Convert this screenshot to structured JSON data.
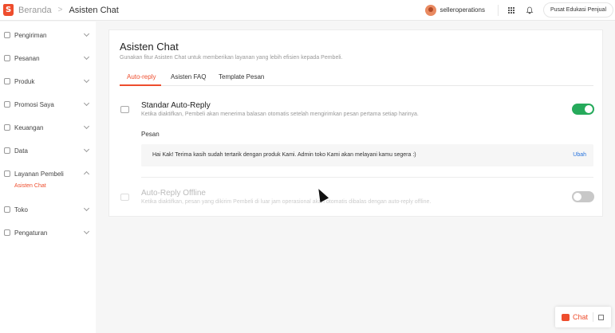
{
  "header": {
    "home_label": "Beranda",
    "separator": ">",
    "page_label": "Asisten Chat",
    "username": "selleroperations",
    "edu_button": "Pusat Edukasi Penjual"
  },
  "sidebar": {
    "items": [
      {
        "label": "Pengiriman",
        "icon": "truck-icon"
      },
      {
        "label": "Pesanan",
        "icon": "order-icon"
      },
      {
        "label": "Produk",
        "icon": "box-icon"
      },
      {
        "label": "Promosi Saya",
        "icon": "tag-icon"
      },
      {
        "label": "Keuangan",
        "icon": "wallet-icon"
      },
      {
        "label": "Data",
        "icon": "chart-icon"
      },
      {
        "label": "Layanan Pembeli",
        "icon": "support-icon",
        "expanded": true
      },
      {
        "label": "Toko",
        "icon": "store-icon"
      },
      {
        "label": "Pengaturan",
        "icon": "gear-icon"
      }
    ],
    "active_sub": "Asisten Chat"
  },
  "main": {
    "title": "Asisten Chat",
    "subtitle": "Gunakan fitur Asisten Chat untuk memberikan layanan yang lebih efisien kepada Pembeli.",
    "tabs": [
      {
        "label": "Auto-reply",
        "active": true
      },
      {
        "label": "Asisten FAQ",
        "active": false
      },
      {
        "label": "Template Pesan",
        "active": false
      }
    ],
    "standard": {
      "title": "Standar Auto-Reply",
      "description": "Ketika diaktifkan, Pembeli akan menerima balasan otomatis setelah mengirimkan pesan pertama setiap harinya.",
      "enabled": true,
      "message_label": "Pesan",
      "message": "Hai Kak! Terima kasih sudah tertarik dengan produk Kami. Admin toko Kami akan melayani kamu segera :)",
      "edit_label": "Ubah"
    },
    "offline": {
      "title": "Auto-Reply Offline",
      "description": "Ketika diaktifkan, pesan yang dikirim Pembeli di luar jam operasional akan otomatis dibalas dengan auto-reply offline.",
      "enabled": false
    }
  },
  "chat_widget": {
    "label": "Chat"
  },
  "colors": {
    "brand": "#ee4d2d",
    "toggle_on": "#26aa5b",
    "link": "#2673dd"
  }
}
